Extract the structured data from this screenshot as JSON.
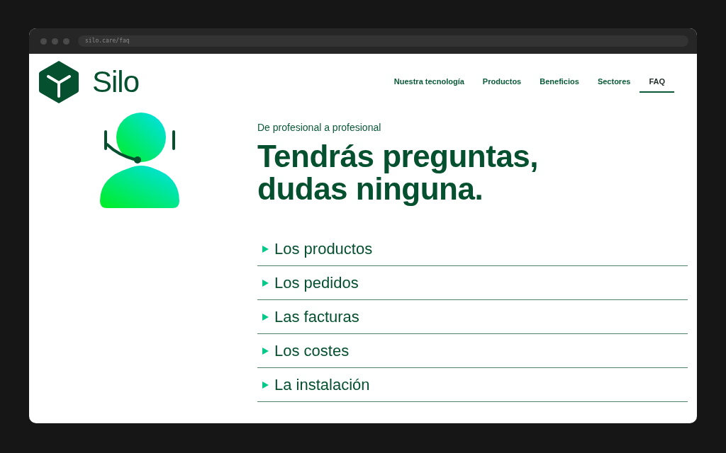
{
  "browser": {
    "url": "silo.care/faq"
  },
  "header": {
    "logo_text": "Silo",
    "nav": [
      {
        "label": "Nuestra tecnología",
        "selected": false
      },
      {
        "label": "Productos",
        "selected": false
      },
      {
        "label": "Beneficios",
        "selected": false
      },
      {
        "label": "Sectores",
        "selected": false
      },
      {
        "label": "FAQ",
        "selected": true
      }
    ]
  },
  "hero": {
    "eyebrow": "De profesional a profesional",
    "title_lines": [
      "Tendrás preguntas,",
      "dudas ninguna."
    ]
  },
  "faq": [
    {
      "label": "Los productos",
      "expanded": false
    },
    {
      "label": "Los pedidos",
      "expanded": false
    },
    {
      "label": "Las facturas",
      "expanded": false
    },
    {
      "label": "Los costes",
      "expanded": false
    },
    {
      "label": "La instalación",
      "expanded": false
    }
  ]
}
